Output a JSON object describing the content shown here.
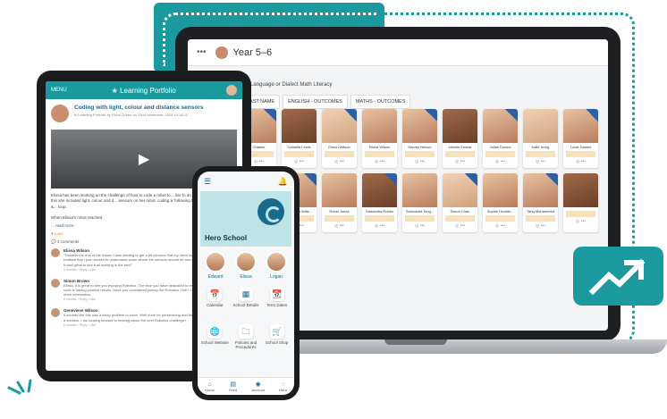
{
  "laptop": {
    "header_title": "Year 5–6",
    "filter_text": "Language or Dialect  Math  Literacy",
    "tabs": [
      "LAST NAME",
      "ENGLISH - OUTCOMES",
      "MATHS - OUTCOMES"
    ],
    "students_row1": [
      "Charles",
      "Camella Lewis",
      "Elmon Wilson",
      "Elissa Wilson",
      "Harvey Nelson",
      "Jasmin Kessar",
      "Julian Downs",
      "Kalia Irving",
      "Louie Dawen"
    ],
    "students_row2": [
      "",
      "Rebecca Wills...",
      "Robin Jones",
      "Samantha Robbs",
      "Samoanet Tong...",
      "Simon Chan",
      "Sophie Huddle...",
      "Tariq Mohammed",
      ""
    ]
  },
  "tablet": {
    "menu": "MENU",
    "title": "Learning Portfolio",
    "post_title": "Coding with light, colour and distance sensors",
    "post_sub": "in Learning Portfolio by Fiona Green on 22nd November, 2024 10:18:22",
    "post_text": "Elissa has been working on the challenge of how to code a robot to... line to an end point. To achieve this she included light, colour and d... sensors on her robot, coding a 'following the line' loop and 'rotate &... loop.",
    "post_text2": "When Elissa's robot reached",
    "read_more": "... read more",
    "love_label": "Love",
    "comments_count": "3 comments",
    "comments": [
      {
        "name": "Elissa Wilson",
        "text": "\"Towards the end of the lesson I was starting to get a bit nervous that my robot wasn't working properly but I realised that I just needed to understand some where the sensors should be and what settings were needed. It was great to see it all working in the end!\"",
        "meta": "8 months  • Reply • Like"
      },
      {
        "name": "Simon Brown",
        "text": "Elissa, it is great to see you enjoying Robotics. The time you have dedicated to reviewing and refining your code is having positive results. Have you considered joining the Robotics Club? Let me know if you'd like more information.",
        "meta": "8 months  • Reply • Like"
      },
      {
        "name": "Genevieve Wilson",
        "text": "It sounds like this was a tricky problem to solve. Well done for persevering and finding different options to find a solution. I am looking forward to hearing about the next Robotics challenge!",
        "meta": "8 months  • Reply • Like"
      }
    ]
  },
  "phone": {
    "school_name": "Hero School",
    "kids": [
      "Edward",
      "Elissa",
      "Logan"
    ],
    "tiles": [
      "Calendar",
      "School Details",
      "Term Dates",
      "School Website",
      "Policies and Procedures",
      "School Shop"
    ],
    "tile_icons": [
      "📅",
      "▦",
      "📆",
      "🌐",
      "🗀",
      "🛒"
    ],
    "nav": [
      "Home",
      "Feed",
      "Account",
      "Hero"
    ],
    "nav_icons": [
      "⌂",
      "▤",
      "◉",
      "◌"
    ]
  },
  "colors": {
    "teal": "#1a9a9e",
    "navy": "#1a6a8e"
  }
}
